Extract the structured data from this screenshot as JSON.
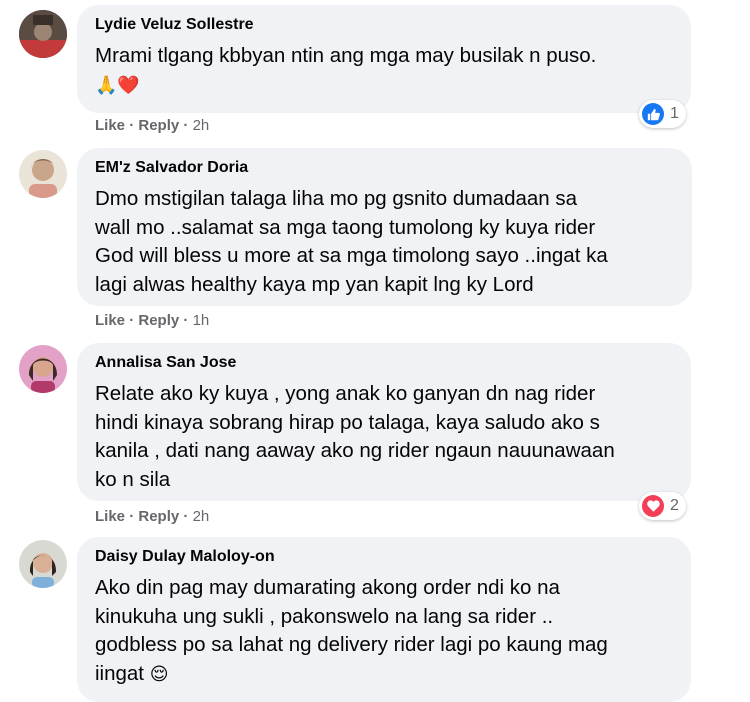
{
  "comments": [
    {
      "author": "Lydie Veluz Sollestre",
      "text": "Mrami tlgang kbbyan ntin ang mga may busilak n puso.",
      "emoji": "🙏❤️",
      "like": "Like",
      "reply": "Reply",
      "sep": "·",
      "time": "2h",
      "reaction": {
        "type": "like",
        "count": "1",
        "color": "#1877f2"
      }
    },
    {
      "author": "EM'z Salvador Doria",
      "text": "Dmo mstigilan talaga liha mo pg gsnito dumadaan sa\nwall mo ..salamat sa mga taong tumolong ky kuya rider\nGod will bless u more at sa mga timolong sayo ..ingat ka\nlagi alwas healthy kaya mp yan kapit lng ky Lord",
      "like": "Like",
      "reply": "Reply",
      "sep": "·",
      "time": "1h"
    },
    {
      "author": "Annalisa San Jose",
      "text": "Relate ako ky kuya , yong anak ko ganyan dn nag rider\nhindi kinaya sobrang hirap po talaga, kaya saludo ako s\nkanila , dati nang aaway ako ng rider ngaun nauunawaan\nko n sila",
      "like": "Like",
      "reply": "Reply",
      "sep": "·",
      "time": "2h",
      "reaction": {
        "type": "love",
        "count": "2",
        "color": "#f33e58"
      }
    },
    {
      "author": "Daisy Dulay Maloloy-on",
      "text": "Ako din pag may dumarating akong order ndi ko na\nkinukuha ung sukli , pakonswelo na lang sa rider ..\ngodbless po sa lahat ng delivery rider lagi po kaung mag\niingat",
      "emoji": "😌"
    }
  ]
}
